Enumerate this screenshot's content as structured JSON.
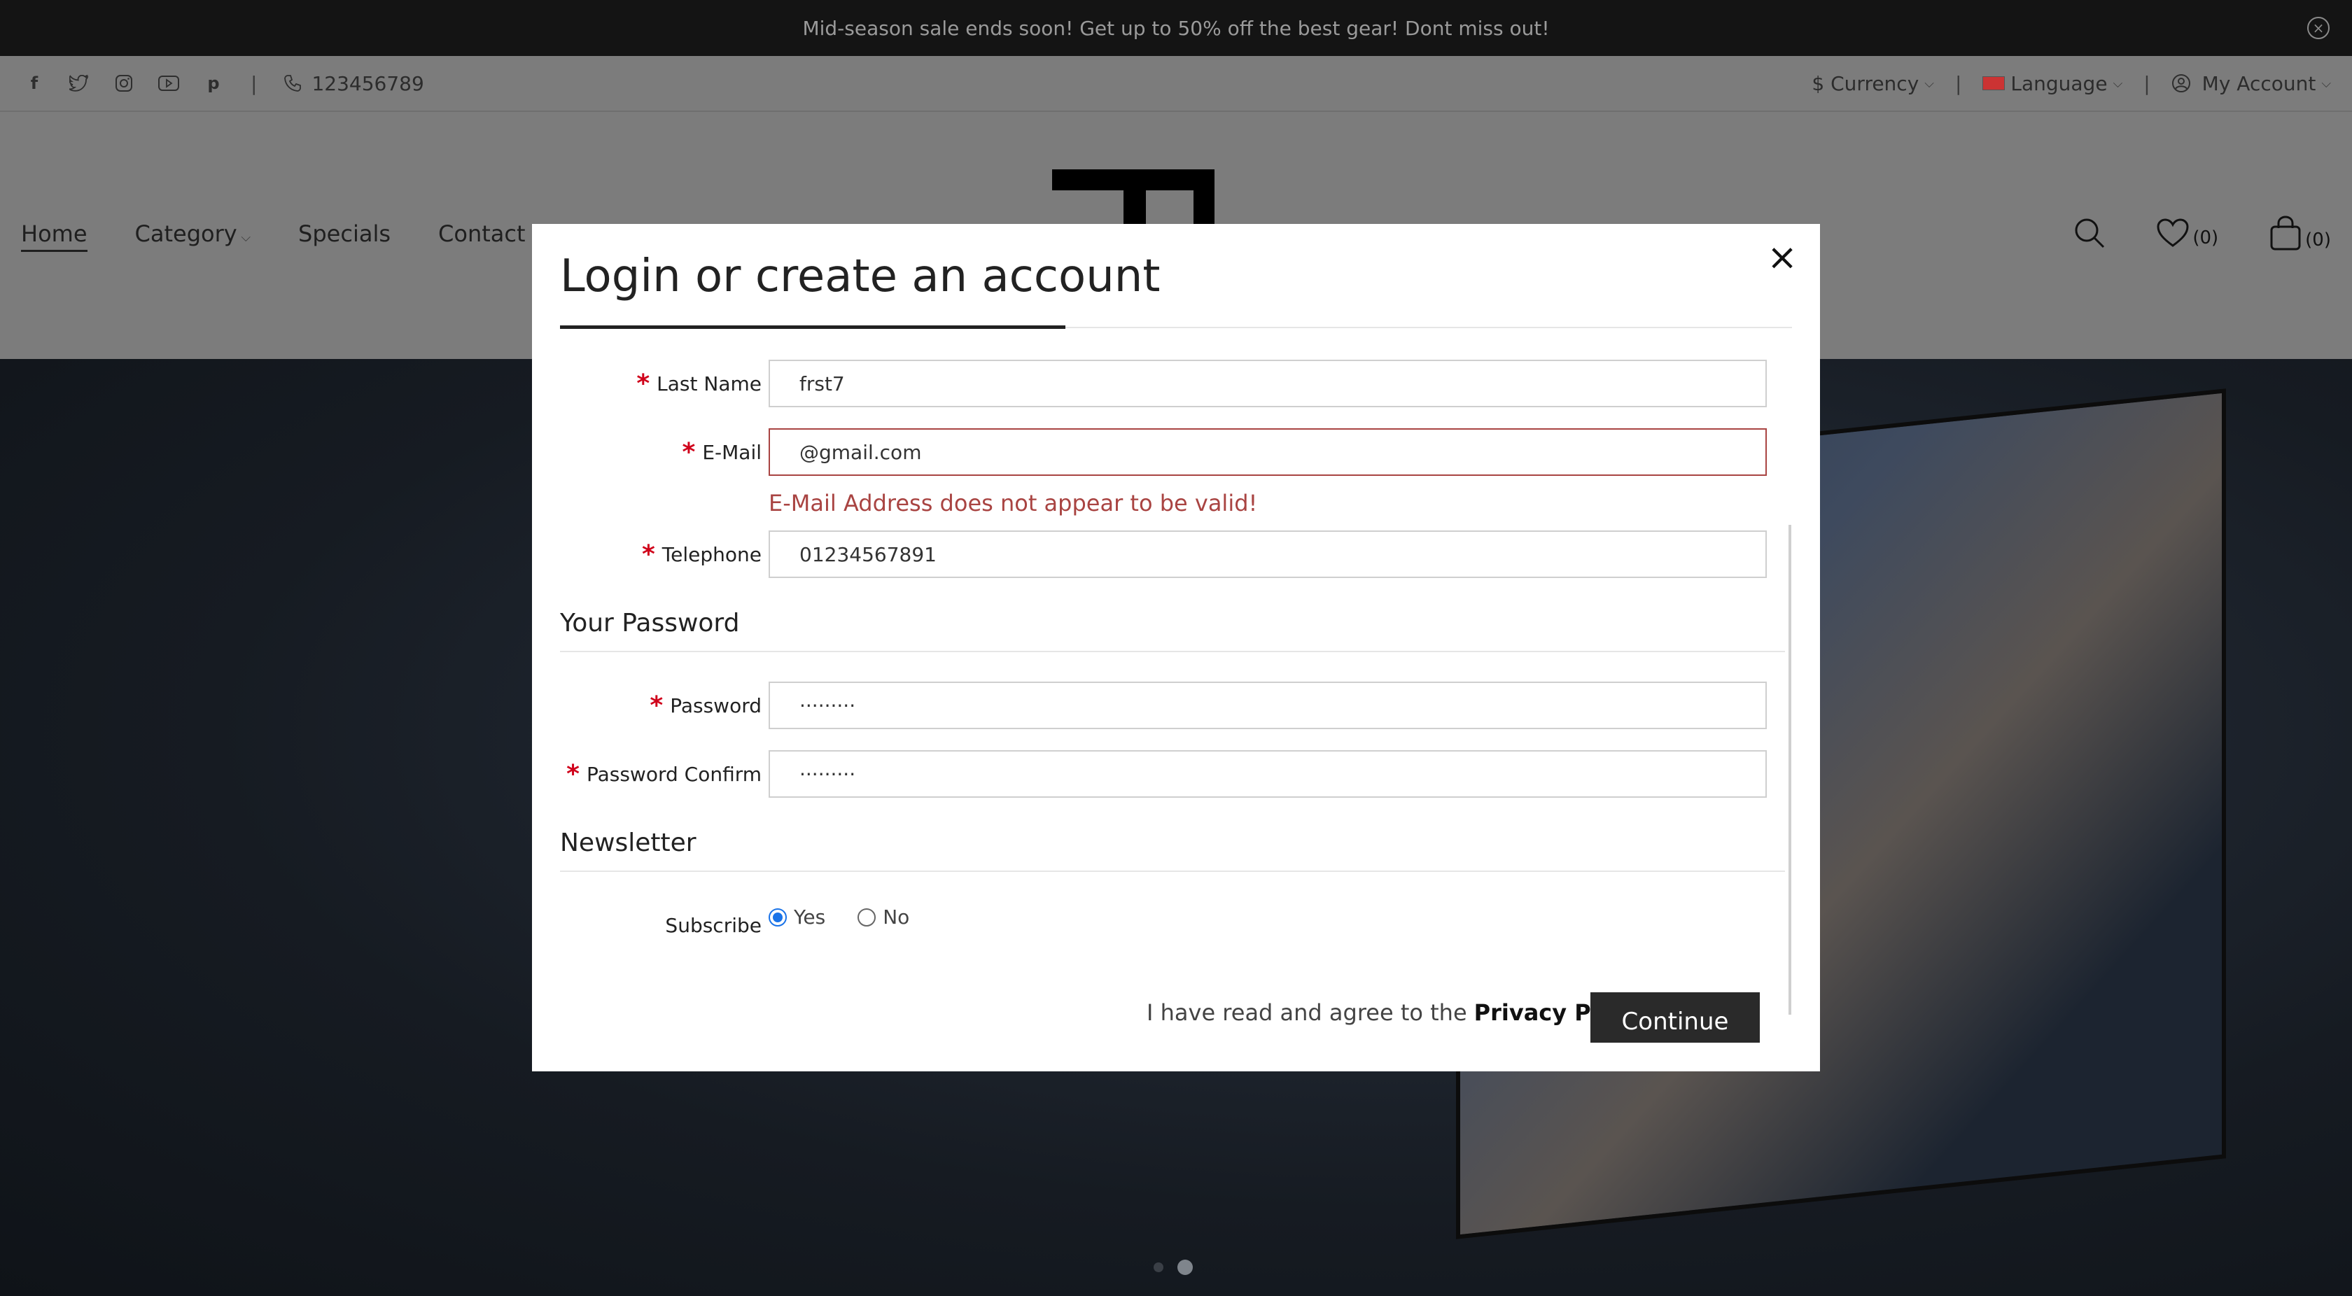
{
  "announcement": {
    "text": "Mid-season sale ends soon! Get up to 50% off the best gear! Dont miss out!"
  },
  "topbar": {
    "social": [
      "facebook-icon",
      "twitter-icon",
      "instagram-icon",
      "youtube-icon",
      "pinterest-icon"
    ],
    "separator": "|",
    "phone": "123456789",
    "currency": "$ Currency",
    "language": "Language",
    "account": "My Account"
  },
  "nav": {
    "items": [
      "Home",
      "Category",
      "Specials",
      "Contact Us"
    ]
  },
  "header_icons": {
    "wishlist_count": "(0)",
    "cart_count": "(0)"
  },
  "modal": {
    "title": "Login or create an account",
    "close": "×",
    "fields": {
      "last_name": {
        "label": "Last Name",
        "value": "frst7"
      },
      "email": {
        "label": "E-Mail",
        "value": "@gmail.com",
        "error": "E-Mail Address does not appear to be valid!"
      },
      "telephone": {
        "label": "Telephone",
        "value": "01234567891"
      },
      "password": {
        "label": "Password",
        "value": "·········"
      },
      "password_confirm": {
        "label": "Password Confirm",
        "value": "·········"
      }
    },
    "required_marker": "*",
    "sections": {
      "password": "Your Password",
      "newsletter": "Newsletter"
    },
    "subscribe": {
      "label": "Subscribe",
      "yes": "Yes",
      "no": "No",
      "selected": "Yes"
    },
    "agree_text": "I have read and agree to the",
    "privacy_policy": "Privacy Policy",
    "privacy_checked": true,
    "continue_label": "Continue"
  },
  "carousel": {
    "slides": 2,
    "active": 2
  },
  "colors": {
    "error": "#a94442",
    "required": "#d0021b",
    "accent": "#1a73e8",
    "button": "#2a2a2a"
  }
}
